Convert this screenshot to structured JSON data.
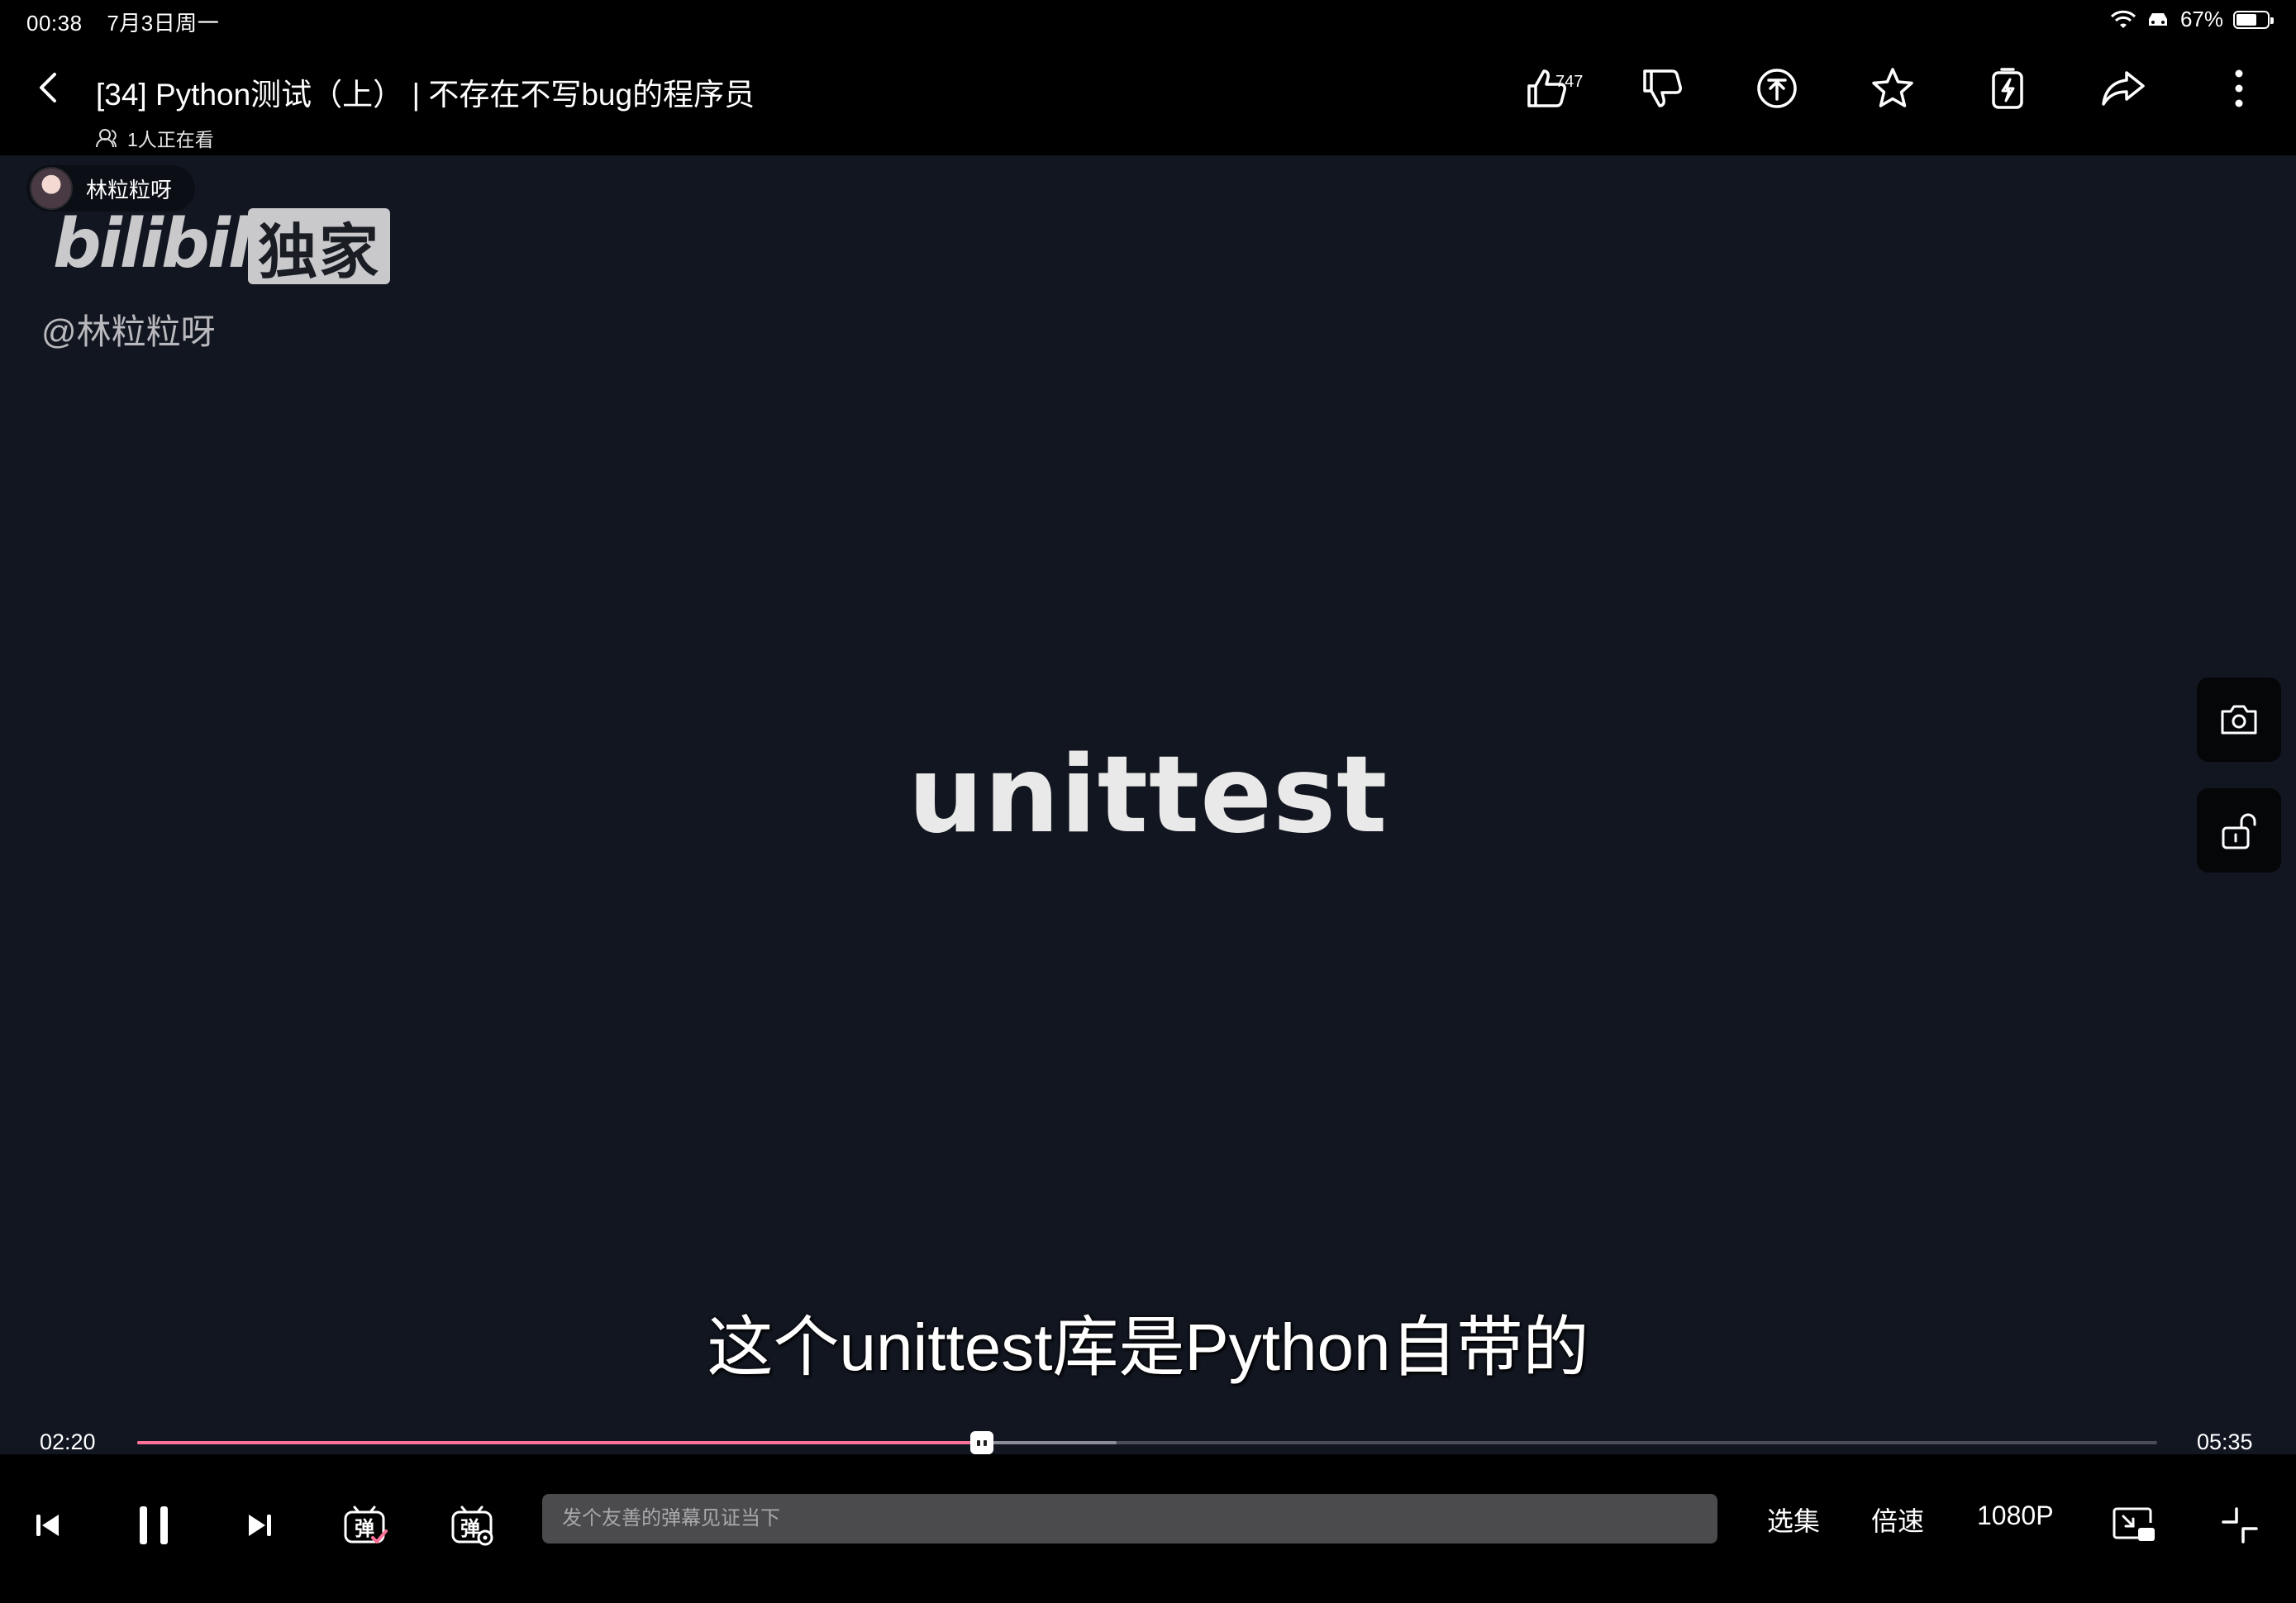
{
  "status": {
    "time": "00:38",
    "date": "7月3日周一",
    "battery": "67%",
    "battery_level": 0.67
  },
  "header": {
    "title": "[34] Python测试（上） | 不存在不写bug的程序员",
    "watching": "1人正在看",
    "like_count": "747",
    "actions": [
      "like-icon",
      "dislike-icon",
      "coin-icon",
      "favorite-icon",
      "charge-icon",
      "share-icon",
      "more-icon"
    ]
  },
  "video": {
    "uploader": "林粒粒呀",
    "watermark_logo": "bilibili",
    "watermark_badge": "独家",
    "watermark_handle": "@林粒粒呀",
    "center_text": "unittest",
    "subtitle": "这个unittest库是Python自带的"
  },
  "player": {
    "current_time": "02:20",
    "duration": "05:35",
    "progress": 0.418,
    "buffered": 0.485
  },
  "controls": {
    "danmaku_placeholder": "发个友善的弹幕见证当下",
    "episodes": "选集",
    "speed": "倍速",
    "quality": "1080P"
  },
  "colors": {
    "accent": "#fb7299",
    "video_bg": "#121620",
    "bar_bg": "#000000"
  }
}
